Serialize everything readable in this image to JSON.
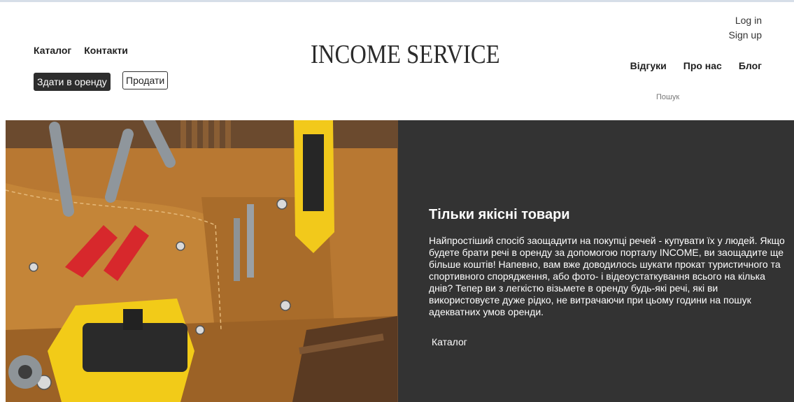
{
  "header": {
    "brand": "INCOME SERVICE",
    "nav_left": [
      "Каталог",
      "Контакти"
    ],
    "rent_button": "Здати в оренду",
    "sell_button": "Продати",
    "auth": {
      "login": "Log in",
      "signup": "Sign up"
    },
    "nav_right": [
      "Відгуки",
      "Про нас",
      "Блог"
    ],
    "search_placeholder": "Пошук"
  },
  "hero": {
    "image_icon": "tool-belt-photo",
    "title": "Тільки якісні товари",
    "text": "Найпростіший спосіб заощадити на покупці речей - купувати їх у людей. Якщо будете брати речі в оренду за допомогою порталу INCOME, ви заощадите ще більше коштів! Напевно, вам вже доводилось шукати прокат туристичного та спортивного спорядження, або фото- і відеоустаткування всього на кілька днів? Тепер ви з легкістю візьмете в оренду будь-які речі, які ви використовуєте дуже рідко, не витрачаючи при цьому години на пошук адекватних умов оренди.",
    "link": "Каталог"
  },
  "colors": {
    "panel": "#333333",
    "button_dark": "#2d2d2d",
    "text": "#1f1f1f"
  }
}
